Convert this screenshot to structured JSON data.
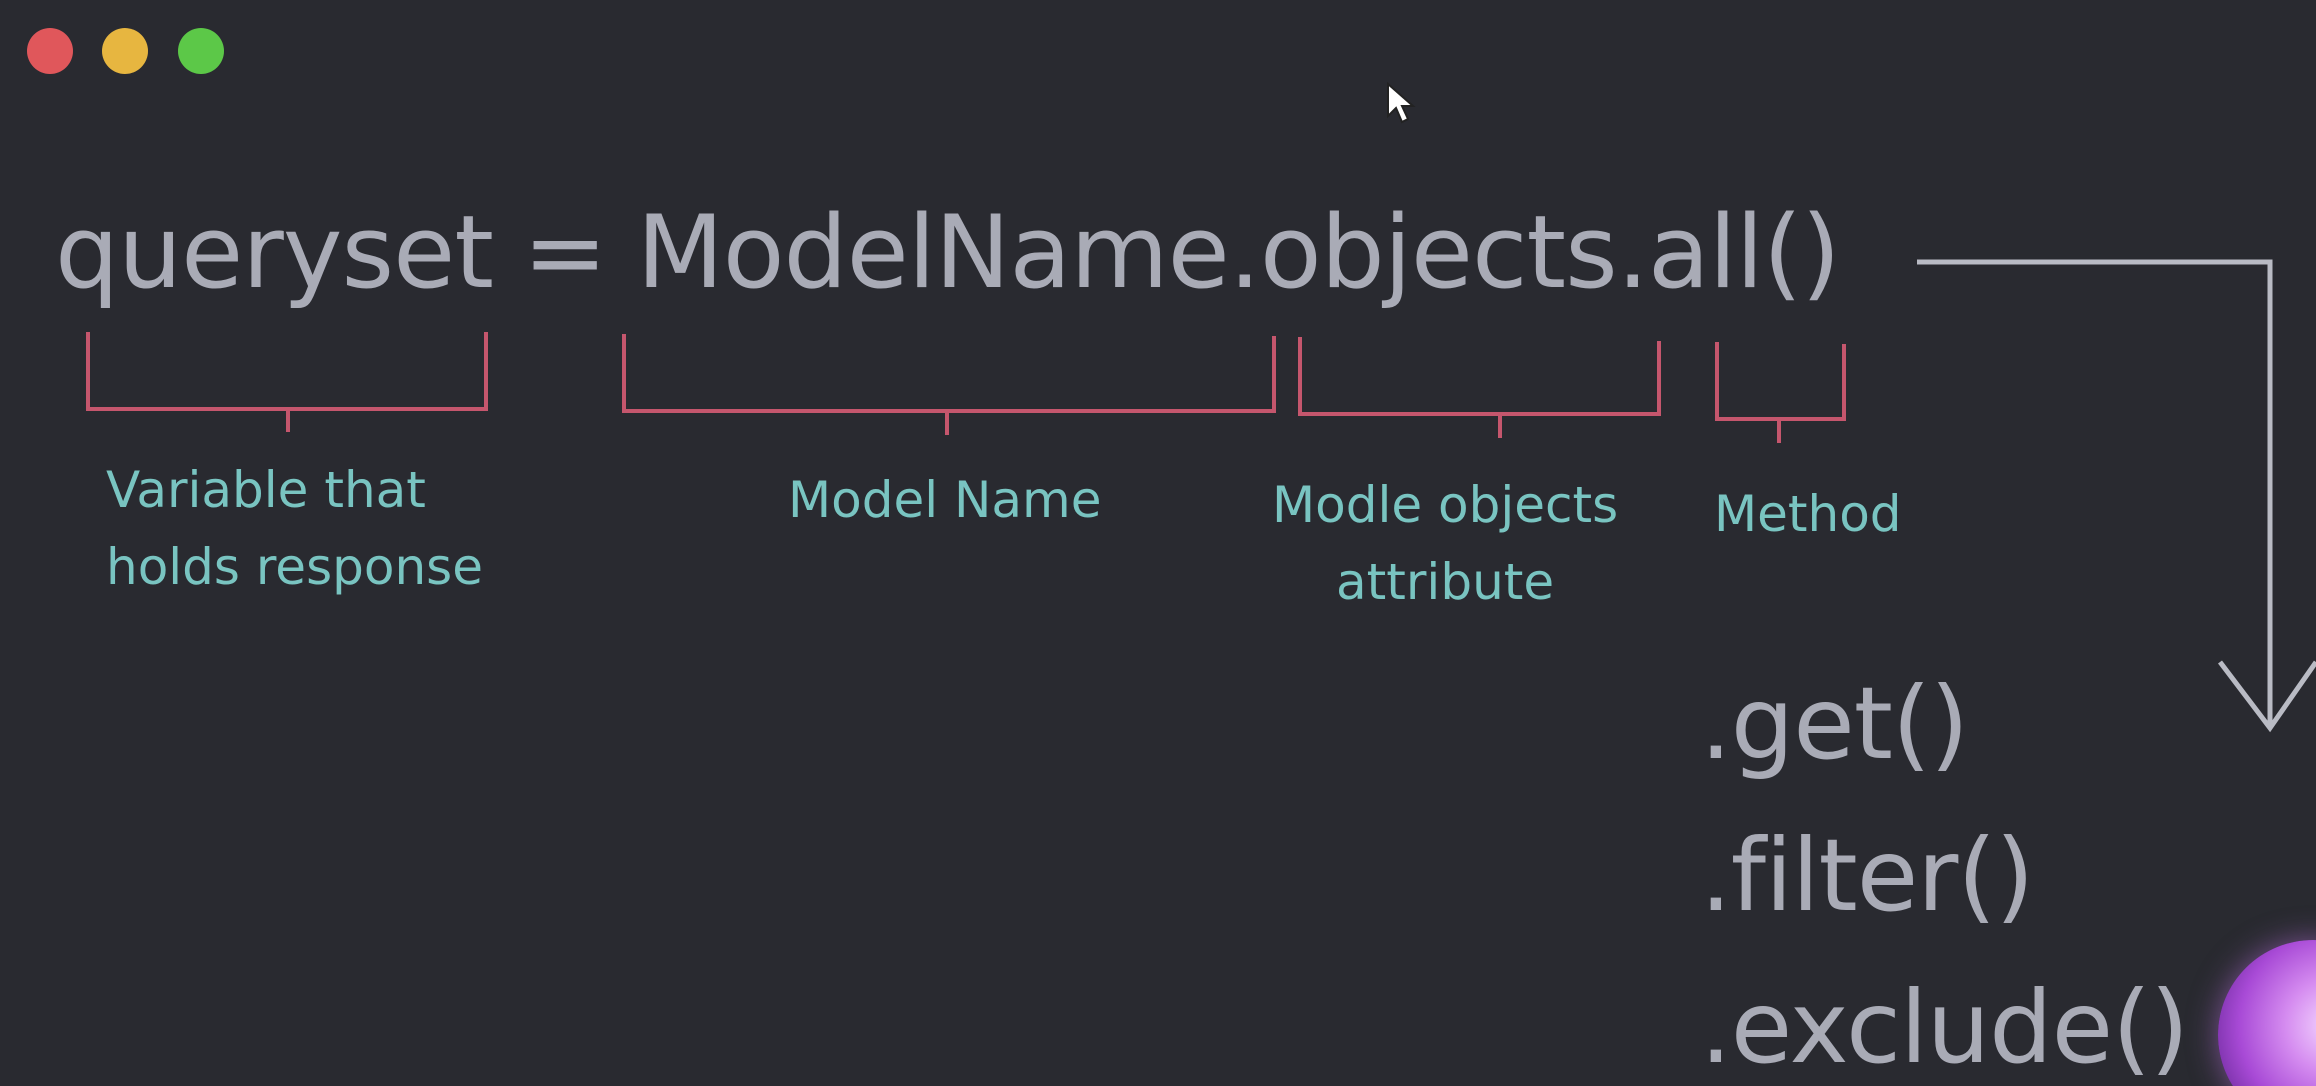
{
  "window_controls": {
    "close_color": "#e0575b",
    "minimize_color": "#e7b640",
    "maximize_color": "#5cc848"
  },
  "code": {
    "variable": "queryset",
    "operator": "=",
    "model": "ModelName",
    "attribute": ".objects",
    "method": ".all()"
  },
  "labels": {
    "variable": [
      "Variable that",
      "holds response"
    ],
    "model": "Model Name",
    "objects": [
      "Modle objects",
      "attribute"
    ],
    "method": "Method"
  },
  "methods": [
    ".get()",
    ".filter()",
    ".exclude()"
  ],
  "colors": {
    "background": "#292a30",
    "code_text": "#a9abb6",
    "label_text": "#79c4c1",
    "bracket": "#c5566d",
    "arrow": "#b9bbc4"
  },
  "icons": {
    "cursor": "mouse-pointer-icon",
    "orb": "assistant-orb-icon"
  }
}
